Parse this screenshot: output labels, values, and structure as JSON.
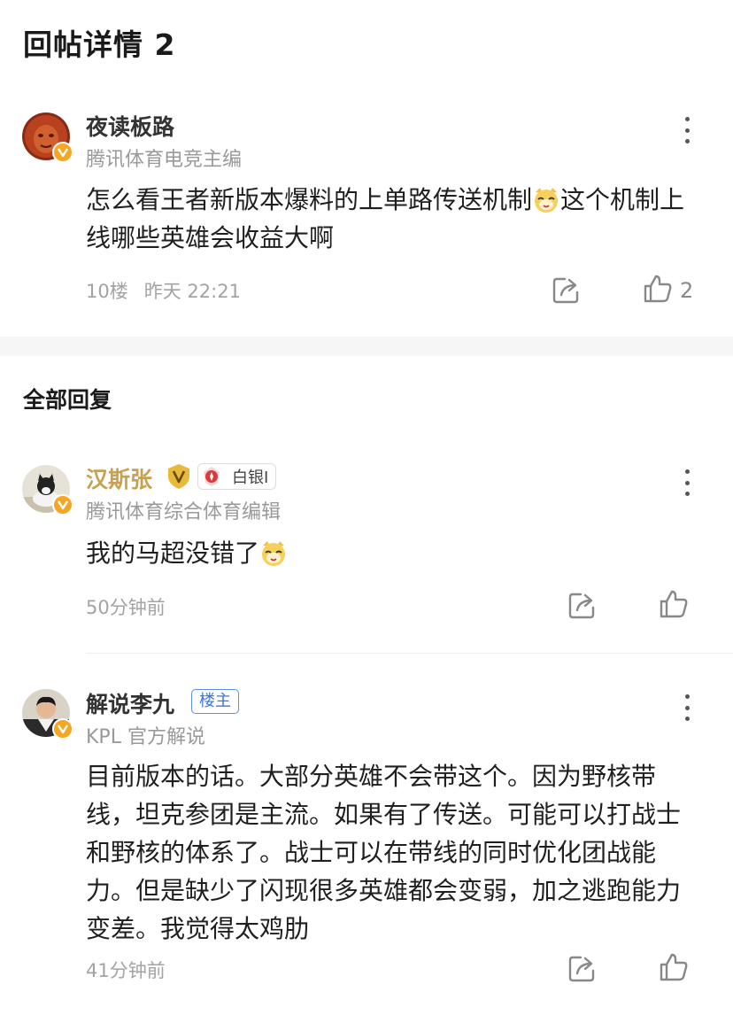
{
  "header": {
    "title": "回帖详情 2"
  },
  "main_post": {
    "username": "夜读板路",
    "subtitle": "腾讯体育电竞主编",
    "content_part1": "怎么看王者新版本爆料的上单路传送机制",
    "content_part2": "这个机制上线哪些英雄会收益大啊",
    "floor": "10楼",
    "time": "昨天 22:21",
    "likes": "2"
  },
  "section": {
    "title": "全部回复"
  },
  "replies": [
    {
      "username": "汉斯张",
      "rank": "白银I",
      "subtitle": "腾讯体育综合体育编辑",
      "content": "我的马超没错了",
      "time": "50分钟前"
    },
    {
      "username": "解说李九",
      "op_label": "楼主",
      "subtitle": "KPL 官方解说",
      "content": "目前版本的话。大部分英雄不会带这个。因为野核带线，坦克参团是主流。如果有了传送。可能可以打战士和野核的体系了。战士可以在带线的同时优化团战能力。但是缺少了闪现很多英雄都会变弱，加之逃跑能力变差。我觉得太鸡肋",
      "time": "41分钟前"
    }
  ],
  "icons": {
    "more": "more-vertical-icon",
    "share": "share-icon",
    "like": "thumbs-up-icon",
    "verified": "verified-v-icon",
    "emoji": "smiling-cat-emoji-icon"
  },
  "colors": {
    "accent_blue": "#3d75de",
    "verified_orange": "#f5a623",
    "gold_name": "#c8a052"
  }
}
